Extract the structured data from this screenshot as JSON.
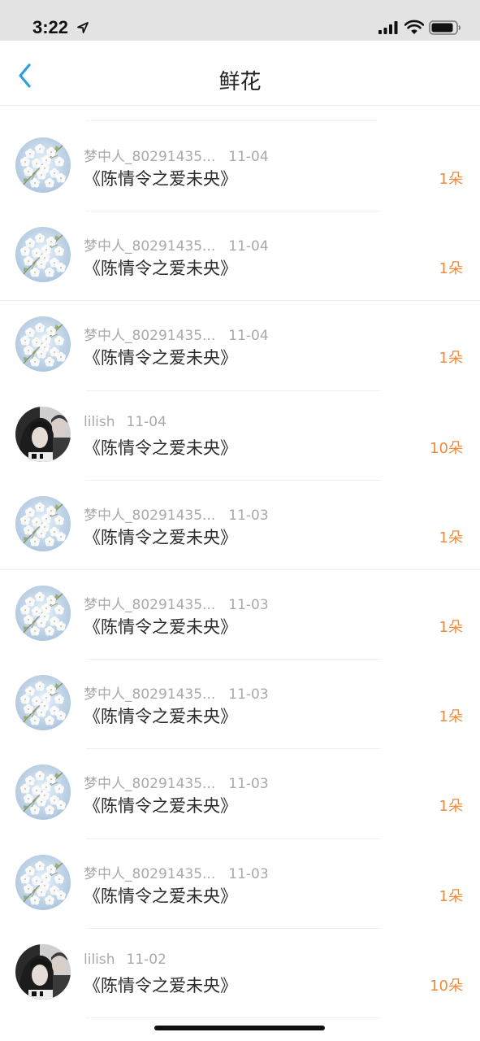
{
  "status_bar": {
    "time": "3:22"
  },
  "header": {
    "title": "鲜花"
  },
  "items": [
    {
      "user": "梦中人_80291435...",
      "date": "11-04",
      "book": "《陈情令之爱未央》",
      "amount": "1朵",
      "avatar": "flower"
    },
    {
      "user": "梦中人_80291435...",
      "date": "11-04",
      "book": "《陈情令之爱未央》",
      "amount": "1朵",
      "avatar": "flower"
    },
    {
      "user": "梦中人_80291435...",
      "date": "11-04",
      "book": "《陈情令之爱未央》",
      "amount": "1朵",
      "avatar": "flower"
    },
    {
      "user": "lilish",
      "date": "11-04",
      "book": "《陈情令之爱未央》",
      "amount": "10朵",
      "avatar": "person"
    },
    {
      "user": "梦中人_80291435...",
      "date": "11-03",
      "book": "《陈情令之爱未央》",
      "amount": "1朵",
      "avatar": "flower"
    },
    {
      "user": "梦中人_80291435...",
      "date": "11-03",
      "book": "《陈情令之爱未央》",
      "amount": "1朵",
      "avatar": "flower"
    },
    {
      "user": "梦中人_80291435...",
      "date": "11-03",
      "book": "《陈情令之爱未央》",
      "amount": "1朵",
      "avatar": "flower"
    },
    {
      "user": "梦中人_80291435...",
      "date": "11-03",
      "book": "《陈情令之爱未央》",
      "amount": "1朵",
      "avatar": "flower"
    },
    {
      "user": "梦中人_80291435...",
      "date": "11-03",
      "book": "《陈情令之爱未央》",
      "amount": "1朵",
      "avatar": "flower"
    },
    {
      "user": "lilish",
      "date": "11-02",
      "book": "《陈情令之爱未央》",
      "amount": "10朵",
      "avatar": "person"
    }
  ],
  "colors": {
    "accent": "#2d9fe0",
    "amount": "#f08a3c",
    "meta": "#a9a9a9",
    "title": "#2b2b2b"
  },
  "icons": [
    "location-arrow-icon",
    "cellular-signal-icon",
    "wifi-icon",
    "battery-icon",
    "back-chevron-icon"
  ]
}
